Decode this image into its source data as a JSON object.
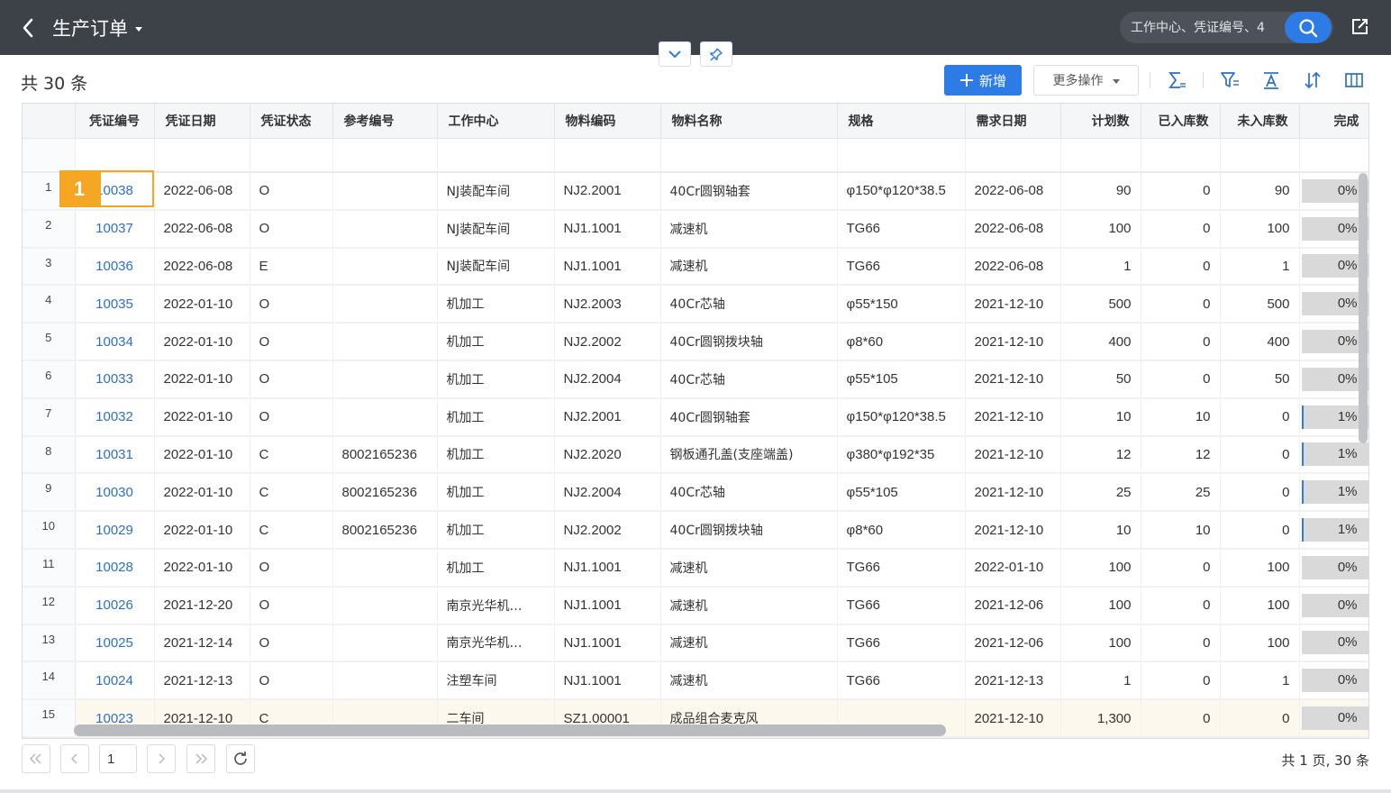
{
  "header": {
    "title": "生产订单",
    "search_placeholder": "工作中心、凭证编号、4"
  },
  "toolbar": {
    "total_count": "共 30 条",
    "new_label": "新增",
    "more_label": "更多操作"
  },
  "step_badge": "1",
  "table": {
    "columns": [
      "凭证编号",
      "凭证日期",
      "凭证状态",
      "参考编号",
      "工作中心",
      "物料编码",
      "物料名称",
      "规格",
      "需求日期",
      "计划数",
      "已入库数",
      "未入库数",
      "完成"
    ],
    "rows": [
      {
        "no": "1",
        "voucher": "10038",
        "date": "2022-06-08",
        "status": "O",
        "ref": "",
        "center": "NJ装配车间",
        "code": "NJ2.2001",
        "name": "40Cr圆钢轴套",
        "spec": "φ150*φ120*38.5",
        "need": "2022-06-08",
        "plan": "90",
        "in": "0",
        "out": "90",
        "done": "0%"
      },
      {
        "no": "2",
        "voucher": "10037",
        "date": "2022-06-08",
        "status": "O",
        "ref": "",
        "center": "NJ装配车间",
        "code": "NJ1.1001",
        "name": "减速机",
        "spec": "TG66",
        "need": "2022-06-08",
        "plan": "100",
        "in": "0",
        "out": "100",
        "done": "0%"
      },
      {
        "no": "3",
        "voucher": "10036",
        "date": "2022-06-08",
        "status": "E",
        "ref": "",
        "center": "NJ装配车间",
        "code": "NJ1.1001",
        "name": "减速机",
        "spec": "TG66",
        "need": "2022-06-08",
        "plan": "1",
        "in": "0",
        "out": "1",
        "done": "0%"
      },
      {
        "no": "4",
        "voucher": "10035",
        "date": "2022-01-10",
        "status": "O",
        "ref": "",
        "center": "机加工",
        "code": "NJ2.2003",
        "name": "40Cr芯轴",
        "spec": "φ55*150",
        "need": "2021-12-10",
        "plan": "500",
        "in": "0",
        "out": "500",
        "done": "0%"
      },
      {
        "no": "5",
        "voucher": "10034",
        "date": "2022-01-10",
        "status": "O",
        "ref": "",
        "center": "机加工",
        "code": "NJ2.2002",
        "name": "40Cr圆钢拨块轴",
        "spec": "φ8*60",
        "need": "2021-12-10",
        "plan": "400",
        "in": "0",
        "out": "400",
        "done": "0%"
      },
      {
        "no": "6",
        "voucher": "10033",
        "date": "2022-01-10",
        "status": "O",
        "ref": "",
        "center": "机加工",
        "code": "NJ2.2004",
        "name": "40Cr芯轴",
        "spec": "φ55*105",
        "need": "2021-12-10",
        "plan": "50",
        "in": "0",
        "out": "50",
        "done": "0%"
      },
      {
        "no": "7",
        "voucher": "10032",
        "date": "2022-01-10",
        "status": "O",
        "ref": "",
        "center": "机加工",
        "code": "NJ2.2001",
        "name": "40Cr圆钢轴套",
        "spec": "φ150*φ120*38.5",
        "need": "2021-12-10",
        "plan": "10",
        "in": "10",
        "out": "0",
        "done": "1%"
      },
      {
        "no": "8",
        "voucher": "10031",
        "date": "2022-01-10",
        "status": "C",
        "ref": "8002165236",
        "center": "机加工",
        "code": "NJ2.2020",
        "name": "钢板通孔盖(支座端盖)",
        "spec": "φ380*φ192*35",
        "need": "2021-12-10",
        "plan": "12",
        "in": "12",
        "out": "0",
        "done": "1%"
      },
      {
        "no": "9",
        "voucher": "10030",
        "date": "2022-01-10",
        "status": "C",
        "ref": "8002165236",
        "center": "机加工",
        "code": "NJ2.2004",
        "name": "40Cr芯轴",
        "spec": "φ55*105",
        "need": "2021-12-10",
        "plan": "25",
        "in": "25",
        "out": "0",
        "done": "1%"
      },
      {
        "no": "10",
        "voucher": "10029",
        "date": "2022-01-10",
        "status": "C",
        "ref": "8002165236",
        "center": "机加工",
        "code": "NJ2.2002",
        "name": "40Cr圆钢拨块轴",
        "spec": "φ8*60",
        "need": "2021-12-10",
        "plan": "10",
        "in": "10",
        "out": "0",
        "done": "1%"
      },
      {
        "no": "11",
        "voucher": "10028",
        "date": "2022-01-10",
        "status": "O",
        "ref": "",
        "center": "机加工",
        "code": "NJ1.1001",
        "name": "减速机",
        "spec": "TG66",
        "need": "2022-01-10",
        "plan": "100",
        "in": "0",
        "out": "100",
        "done": "0%"
      },
      {
        "no": "12",
        "voucher": "10026",
        "date": "2021-12-20",
        "status": "O",
        "ref": "",
        "center": "南京光华机…",
        "code": "NJ1.1001",
        "name": "减速机",
        "spec": "TG66",
        "need": "2021-12-06",
        "plan": "100",
        "in": "0",
        "out": "100",
        "done": "0%"
      },
      {
        "no": "13",
        "voucher": "10025",
        "date": "2021-12-14",
        "status": "O",
        "ref": "",
        "center": "南京光华机…",
        "code": "NJ1.1001",
        "name": "减速机",
        "spec": "TG66",
        "need": "2021-12-06",
        "plan": "100",
        "in": "0",
        "out": "100",
        "done": "0%"
      },
      {
        "no": "14",
        "voucher": "10024",
        "date": "2021-12-13",
        "status": "O",
        "ref": "",
        "center": "注塑车间",
        "code": "NJ1.1001",
        "name": "减速机",
        "spec": "TG66",
        "need": "2021-12-13",
        "plan": "1",
        "in": "0",
        "out": "1",
        "done": "0%"
      },
      {
        "no": "15",
        "voucher": "10023",
        "date": "2021-12-10",
        "status": "C",
        "ref": "",
        "center": "二车间",
        "code": "SZ1.00001",
        "name": "成品组合麦克风",
        "spec": "",
        "need": "2021-12-10",
        "plan": "1,300",
        "in": "0",
        "out": "0",
        "done": "0%"
      }
    ]
  },
  "pagination": {
    "page": "1",
    "summary": "共 1 页, 30 条"
  }
}
